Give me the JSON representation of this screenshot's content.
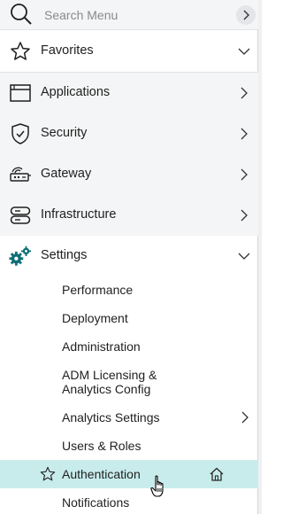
{
  "search": {
    "placeholder": "Search Menu"
  },
  "nav": {
    "favorites": "Favorites",
    "applications": "Applications",
    "security": "Security",
    "gateway": "Gateway",
    "infrastructure": "Infrastructure",
    "settings": "Settings"
  },
  "settings_items": {
    "performance": "Performance",
    "deployment": "Deployment",
    "administration": "Administration",
    "adm_licensing_line1": "ADM Licensing &",
    "adm_licensing_line2": "Analytics Config",
    "analytics_settings": "Analytics Settings",
    "users_roles": "Users & Roles",
    "authentication": "Authentication",
    "notifications": "Notifications"
  },
  "colors": {
    "active_row": "#c8ecec",
    "settings_icon": "#0f6e78",
    "shaded_row": "#f4f5f6"
  },
  "icons": {
    "search": "magnifier-icon",
    "favorites": "star-icon",
    "applications": "window-icon",
    "security": "shield-check-icon",
    "gateway": "gateway-icon",
    "infrastructure": "server-icon",
    "settings": "gears-icon",
    "authentication_fav": "star-outline-icon",
    "authentication_home": "home-icon"
  }
}
